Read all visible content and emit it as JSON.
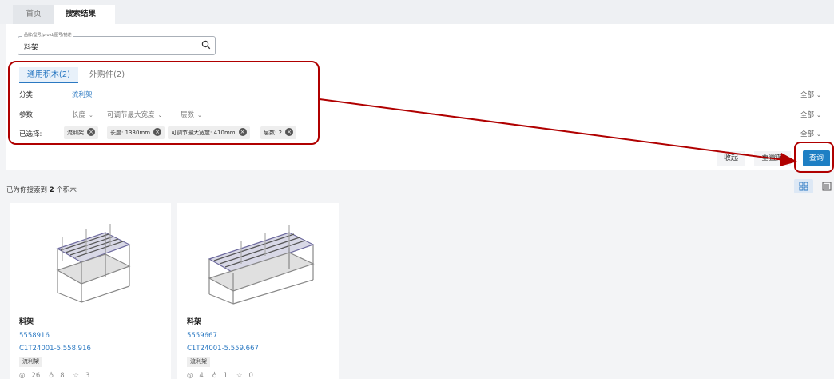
{
  "tabs": {
    "home": "首页",
    "active": "搜索结果",
    "close": "✕"
  },
  "search": {
    "legend": "品牌/型号/proId/图号/描述",
    "value": "料架"
  },
  "type_tabs": {
    "common": "通用积木(2)",
    "purchased": "外购件(2)"
  },
  "filters": {
    "category_label": "分类:",
    "category_value": "流利架",
    "param_label": "参数:",
    "params": [
      "长度",
      "可调节最大宽度",
      "层数"
    ],
    "selected_label": "已选择:",
    "chips": [
      "流利架",
      "长度: 1330mm",
      "可调节最大宽度: 410mm",
      "层数: 2"
    ],
    "all_label": "全部"
  },
  "actions": {
    "collapse": "收起",
    "reset": "重置筛",
    "query": "查询"
  },
  "results": {
    "prefix": "已为你搜索到",
    "count": "2",
    "suffix": "个积木"
  },
  "cards": [
    {
      "title": "料架",
      "code": "5558916",
      "sku": "C1T24001-5.558.916",
      "tag": "流利架",
      "views": "26",
      "likes": "8",
      "favorites": "3"
    },
    {
      "title": "料架",
      "code": "5559667",
      "sku": "C1T24001-5.559.667",
      "tag": "流利架",
      "views": "4",
      "likes": "1",
      "favorites": "0"
    }
  ],
  "colors": {
    "accent": "#2b79c2",
    "primary_button": "#1e7fc4",
    "annotation": "#b00000"
  }
}
